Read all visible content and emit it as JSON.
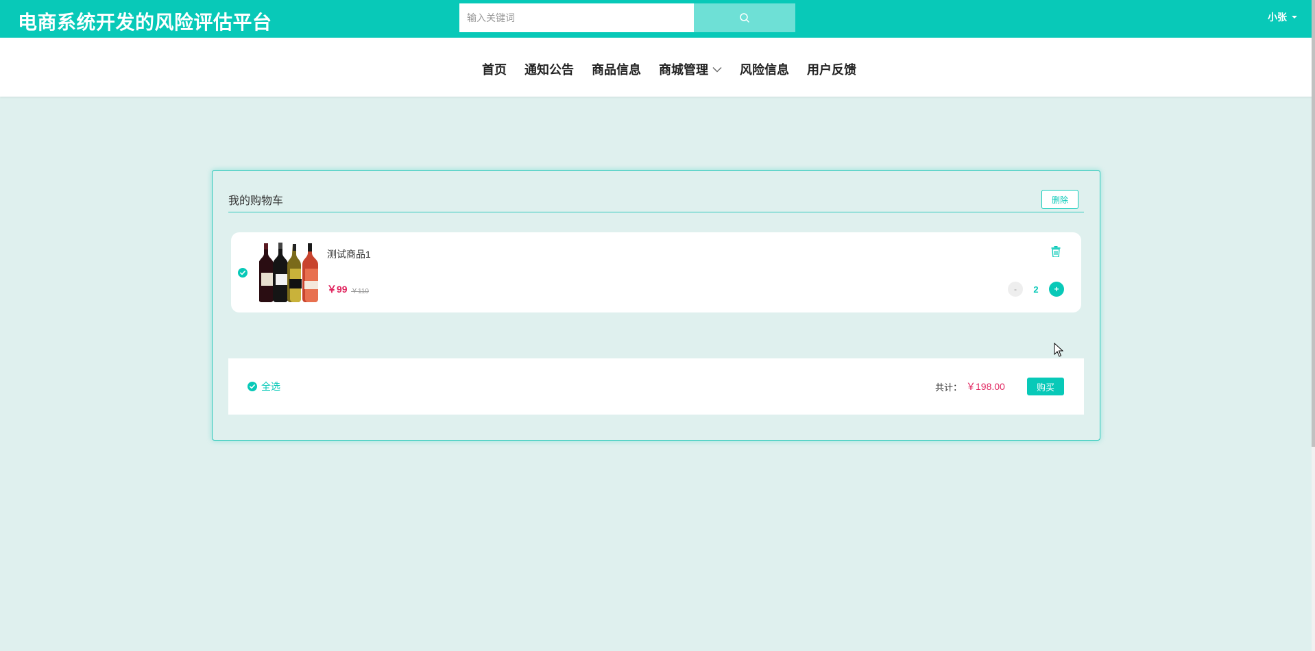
{
  "header": {
    "title": "电商系统开发的风险评估平台",
    "search_placeholder": "输入关键词",
    "user_name": "小张"
  },
  "nav": {
    "items": [
      {
        "label": "首页"
      },
      {
        "label": "通知公告"
      },
      {
        "label": "商品信息"
      },
      {
        "label": "商城管理",
        "has_dropdown": true
      },
      {
        "label": "风险信息"
      },
      {
        "label": "用户反馈"
      }
    ]
  },
  "cart": {
    "title": "我的购物车",
    "delete_label": "删除",
    "items": [
      {
        "name": "测试商品1",
        "price": "￥99",
        "old_price": "￥110",
        "quantity": "2",
        "minus_label": "-",
        "plus_label": "+",
        "checked": true
      }
    ],
    "footer": {
      "select_all_label": "全选",
      "total_label": "共计：",
      "total_value": "￥198.00",
      "buy_label": "购买"
    }
  },
  "colors": {
    "brand": "#08c9b8",
    "price": "#e0245e",
    "page_bg": "#dff0ee"
  },
  "icons": {
    "search": "search-icon",
    "trash": "trash-icon",
    "check": "check-icon",
    "chevron": "chevron-down-icon"
  }
}
